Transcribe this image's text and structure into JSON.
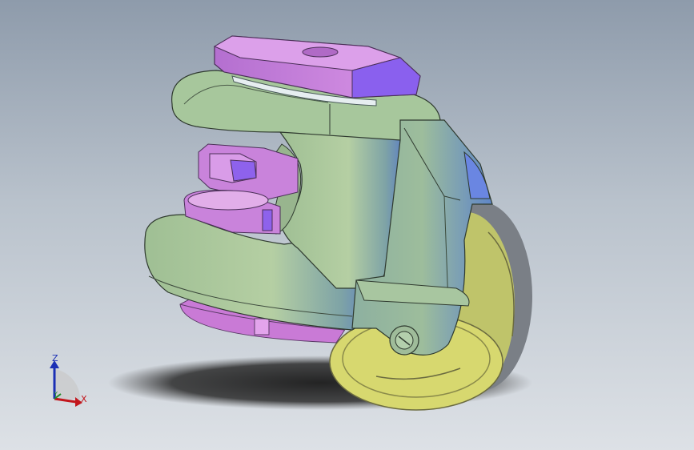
{
  "viewport": {
    "background_top": "#8e9bab",
    "background_bottom": "#dde1e6"
  },
  "model": {
    "parts": [
      {
        "name": "hex-nut",
        "color": "#c27fd8"
      },
      {
        "name": "housing",
        "color": "#a3c39a"
      },
      {
        "name": "bracket",
        "color": "#8fb4a8"
      },
      {
        "name": "wheel",
        "color": "#d8d86e"
      },
      {
        "name": "accent-face",
        "color": "#7f5cf0"
      }
    ]
  },
  "triad": {
    "z_label": "Z",
    "x_label": "X",
    "y_label": "Y",
    "z_color": "#1b2fb5",
    "x_color": "#c2161c",
    "y_color": "#1f8a2a"
  }
}
